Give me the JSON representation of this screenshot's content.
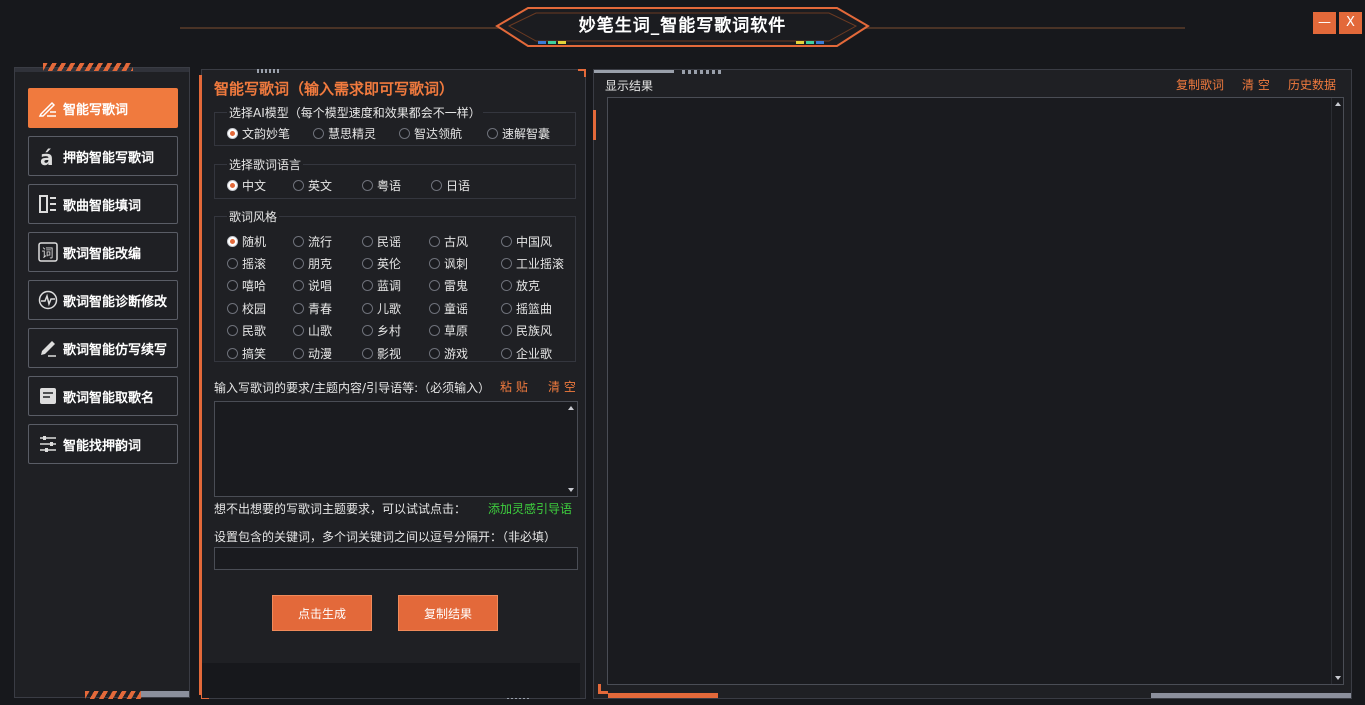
{
  "window": {
    "title": "妙笔生词_智能写歌词软件",
    "minimize_label": "—",
    "close_label": "X"
  },
  "colors": {
    "accent": "#e3693a",
    "accent_light": "#f07a3e",
    "background": "#17181c",
    "panel": "#1f2024",
    "link_green": "#3ecf3e"
  },
  "nav": {
    "items": [
      {
        "label": "智能写歌词",
        "icon": "pencil-lines-icon",
        "active": true
      },
      {
        "label": "押韵智能写歌词",
        "icon": "letter-a-accent-icon",
        "active": false
      },
      {
        "label": "歌曲智能填词",
        "icon": "list-document-icon",
        "active": false
      },
      {
        "label": "歌词智能改编",
        "icon": "ci-character-icon",
        "active": false
      },
      {
        "label": "歌词智能诊断修改",
        "icon": "pulse-wave-icon",
        "active": false
      },
      {
        "label": "歌词智能仿写续写",
        "icon": "pencil-icon",
        "active": false
      },
      {
        "label": "歌词智能取歌名",
        "icon": "document-icon",
        "active": false
      },
      {
        "label": "智能找押韵词",
        "icon": "sliders-icon",
        "active": false
      }
    ]
  },
  "center": {
    "title": "智能写歌词（输入需求即可写歌词）",
    "model_group": {
      "legend": "选择AI模型（每个模型速度和效果都会不一样）",
      "options": [
        "文韵妙笔",
        "慧思精灵",
        "智达领航",
        "速解智囊"
      ],
      "selected": "文韵妙笔"
    },
    "language_group": {
      "legend": "选择歌词语言",
      "options": [
        "中文",
        "英文",
        "粤语",
        "日语"
      ],
      "selected": "中文"
    },
    "style_group": {
      "legend": "歌词风格",
      "options": [
        "随机",
        "流行",
        "民谣",
        "古风",
        "中国风",
        "摇滚",
        "朋克",
        "英伦",
        "讽刺",
        "工业摇滚",
        "嘻哈",
        "说唱",
        "蓝调",
        "雷鬼",
        "放克",
        "校园",
        "青春",
        "儿歌",
        "童谣",
        "摇篮曲",
        "民歌",
        "山歌",
        "乡村",
        "草原",
        "民族风",
        "搞笑",
        "动漫",
        "影视",
        "游戏",
        "企业歌"
      ],
      "selected": "随机"
    },
    "prompt_label": "输入写歌词的要求/主题内容/引导语等:（必须输入）",
    "paste_label": "粘 贴",
    "clear_label": "清 空",
    "prompt_value": "",
    "hint_text": "想不出想要的写歌词主题要求，可以试试点击：",
    "inspire_link": "添加灵感引导语",
    "keyword_label": "设置包含的关键词，多个词关键词之间以逗号分隔开：（非必填）",
    "keyword_value": "",
    "generate_label": "点击生成",
    "copy_result_label": "复制结果"
  },
  "result": {
    "title": "显示结果",
    "copy_lyrics_label": "复制歌词",
    "clear_label": "清 空",
    "history_label": "历史数据",
    "content": ""
  }
}
